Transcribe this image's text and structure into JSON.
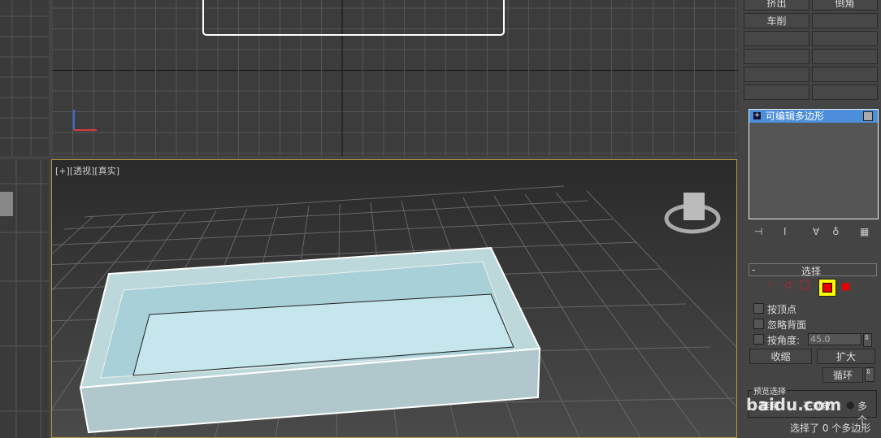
{
  "viewport_perspective": {
    "plus": "[+]",
    "view": "[透视]",
    "shading": "[真实]"
  },
  "command_panel": {
    "object_buttons": [
      "挤出",
      "倒角",
      "车削",
      "",
      "",
      "",
      "",
      "",
      "",
      "",
      "",
      ""
    ],
    "modifier_stack": {
      "item": "可编辑多边形"
    },
    "selection_rollout": {
      "title": "选择",
      "collapse": "-",
      "by_vertex": "按顶点",
      "ignore_backfacing": "忽略背面",
      "by_angle": "按角度:",
      "angle_value": "45.0",
      "shrink": "收缩",
      "grow": "扩大",
      "loop": "循环",
      "preview_title": "预览选择",
      "preview_off": "禁用",
      "preview_subobj": "子对象",
      "preview_multi": "多个",
      "status": "选择了 0 个多边形"
    }
  },
  "watermark": "baidu.com",
  "colors": {
    "accent": "#4c8ed9",
    "viewport_border": "#b89a3a",
    "highlight": "#ffff00"
  }
}
